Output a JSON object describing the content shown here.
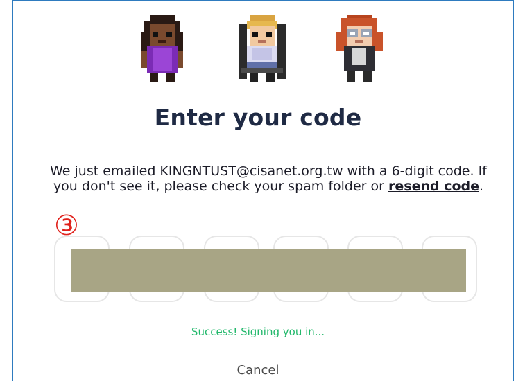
{
  "page": {
    "title": "Enter your code",
    "description_before": "We just emailed KINGNTUST@cisanet.org.tw with a 6-digit code. If you don't see it, please check your spam folder or ",
    "resend_link": "resend code",
    "description_after": ".",
    "step_marker": "③",
    "status_message": "Success! Signing you in...",
    "cancel_label": "Cancel"
  },
  "avatars": [
    {
      "icon": "pixel-avatar-purple-dress-icon"
    },
    {
      "icon": "pixel-avatar-wheelchair-icon"
    },
    {
      "icon": "pixel-avatar-redhead-glasses-icon"
    }
  ],
  "code_inputs": [
    "",
    "",
    "",
    "",
    "",
    ""
  ],
  "colors": {
    "frame_border": "#2e7bbf",
    "title": "#1f2a44",
    "status": "#22b86b",
    "redaction": "#a8a585",
    "step_marker": "#e0201a"
  }
}
